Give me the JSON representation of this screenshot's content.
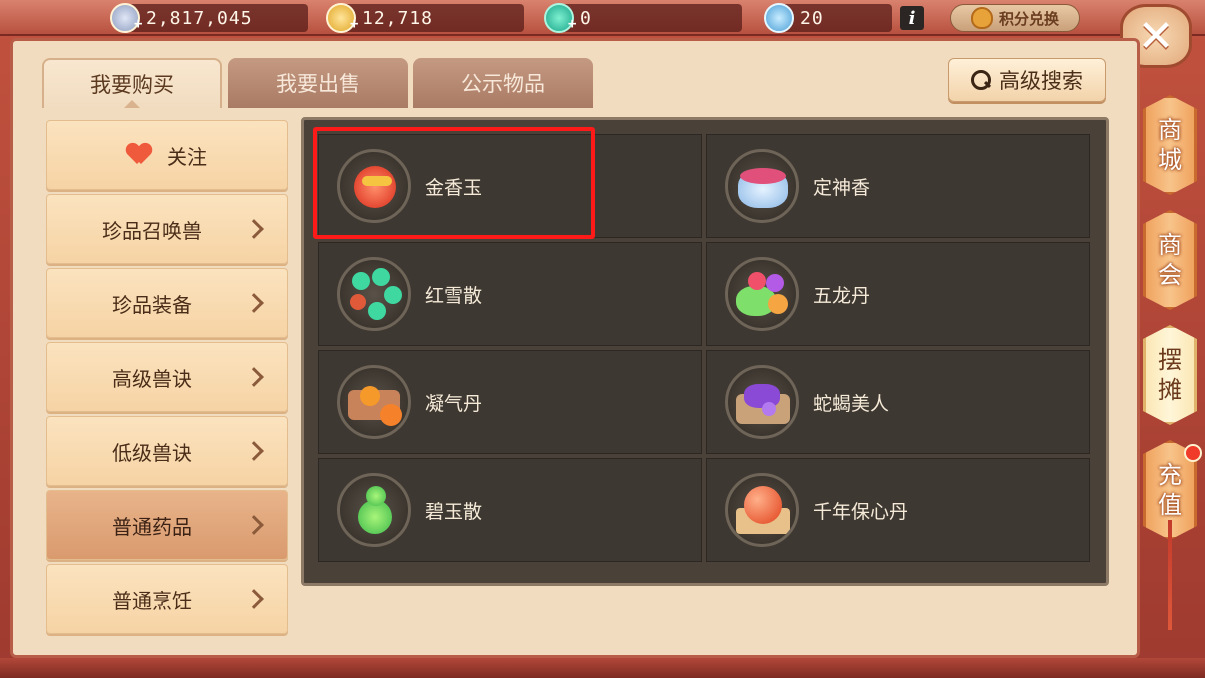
{
  "resources": {
    "silver": "2,817,045",
    "gold": "12,718",
    "jade": "0",
    "tickets": "20"
  },
  "info_label": "i",
  "points_exchange_label": "积分兑换",
  "close_label": "✕",
  "tabs": [
    {
      "label": "我要购买",
      "active": true
    },
    {
      "label": "我要出售",
      "active": false
    },
    {
      "label": "公示物品",
      "active": false
    }
  ],
  "advanced_search_label": "高级搜索",
  "sidebar": [
    {
      "label": "关注",
      "active": false,
      "type": "favorite"
    },
    {
      "label": "珍品召唤兽",
      "active": false
    },
    {
      "label": "珍品装备",
      "active": false
    },
    {
      "label": "高级兽诀",
      "active": false
    },
    {
      "label": "低级兽诀",
      "active": false
    },
    {
      "label": "普通药品",
      "active": true
    },
    {
      "label": "普通烹饪",
      "active": false
    }
  ],
  "items": [
    {
      "name": "金香玉",
      "icon": "red-gold-pill-icon",
      "highlighted": true
    },
    {
      "name": "定神香",
      "icon": "pink-bowl-icon"
    },
    {
      "name": "红雪散",
      "icon": "green-bead-bracelet-icon"
    },
    {
      "name": "五龙丹",
      "icon": "colorful-pills-icon"
    },
    {
      "name": "凝气丹",
      "icon": "orange-box-icon"
    },
    {
      "name": "蛇蝎美人",
      "icon": "purple-scorpion-box-icon"
    },
    {
      "name": "碧玉散",
      "icon": "green-jade-gourd-icon"
    },
    {
      "name": "千年保心丹",
      "icon": "red-orb-scroll-icon"
    }
  ],
  "side_tabs": [
    {
      "label": [
        "商",
        "城"
      ],
      "selected": false
    },
    {
      "label": [
        "商",
        "会"
      ],
      "selected": false
    },
    {
      "label": [
        "摆",
        "摊"
      ],
      "selected": true
    },
    {
      "label": [
        "充",
        "值"
      ],
      "selected": false
    }
  ],
  "colors": {
    "frame": "#b8453a",
    "panel": "#f1dcc0",
    "grid_bg": "#4a4238",
    "highlight_border": "#ff1a1a"
  }
}
